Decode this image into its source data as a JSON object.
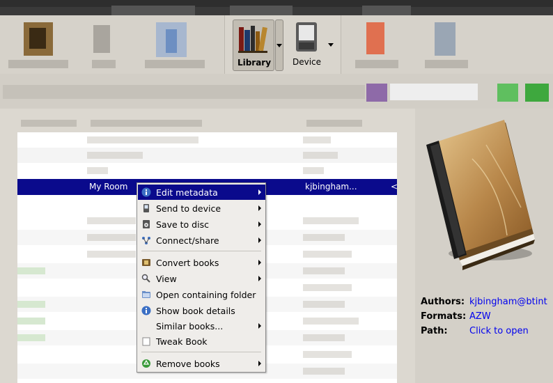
{
  "toolbar": {
    "library_label": "Library",
    "device_label": "Device"
  },
  "book_list": {
    "selected_row": {
      "title": "My Room",
      "author": "kjbingham...",
      "trailing": "<"
    }
  },
  "context_menu": {
    "items": [
      {
        "label": "Edit metadata",
        "icon": "info-icon",
        "submenu": true,
        "highlighted": true
      },
      {
        "label": "Send to device",
        "icon": "device-icon",
        "submenu": true
      },
      {
        "label": "Save to disc",
        "icon": "disk-icon",
        "submenu": true
      },
      {
        "label": "Connect/share",
        "icon": "network-icon",
        "submenu": true
      },
      {
        "label": "Convert books",
        "icon": "convert-icon",
        "submenu": true
      },
      {
        "label": "View",
        "icon": "magnifier-icon",
        "submenu": true
      },
      {
        "label": "Open containing folder",
        "icon": "folder-icon",
        "submenu": false
      },
      {
        "label": "Show book details",
        "icon": "info-icon",
        "submenu": false
      },
      {
        "label": "Similar books...",
        "icon": "none",
        "submenu": true
      },
      {
        "label": "Tweak Book",
        "icon": "tweak-icon",
        "submenu": false
      },
      {
        "label": "Remove books",
        "icon": "recycle-icon",
        "submenu": true
      }
    ]
  },
  "book_details": {
    "authors_label": "Authors:",
    "authors_value": "kjbingham@btint",
    "formats_label": "Formats:",
    "formats_value": "AZW",
    "path_label": "Path:",
    "path_value": "Click to open"
  },
  "colors": {
    "selection": "#0a0a8c",
    "link": "#0000ee",
    "menu_bg": "#efedea"
  }
}
